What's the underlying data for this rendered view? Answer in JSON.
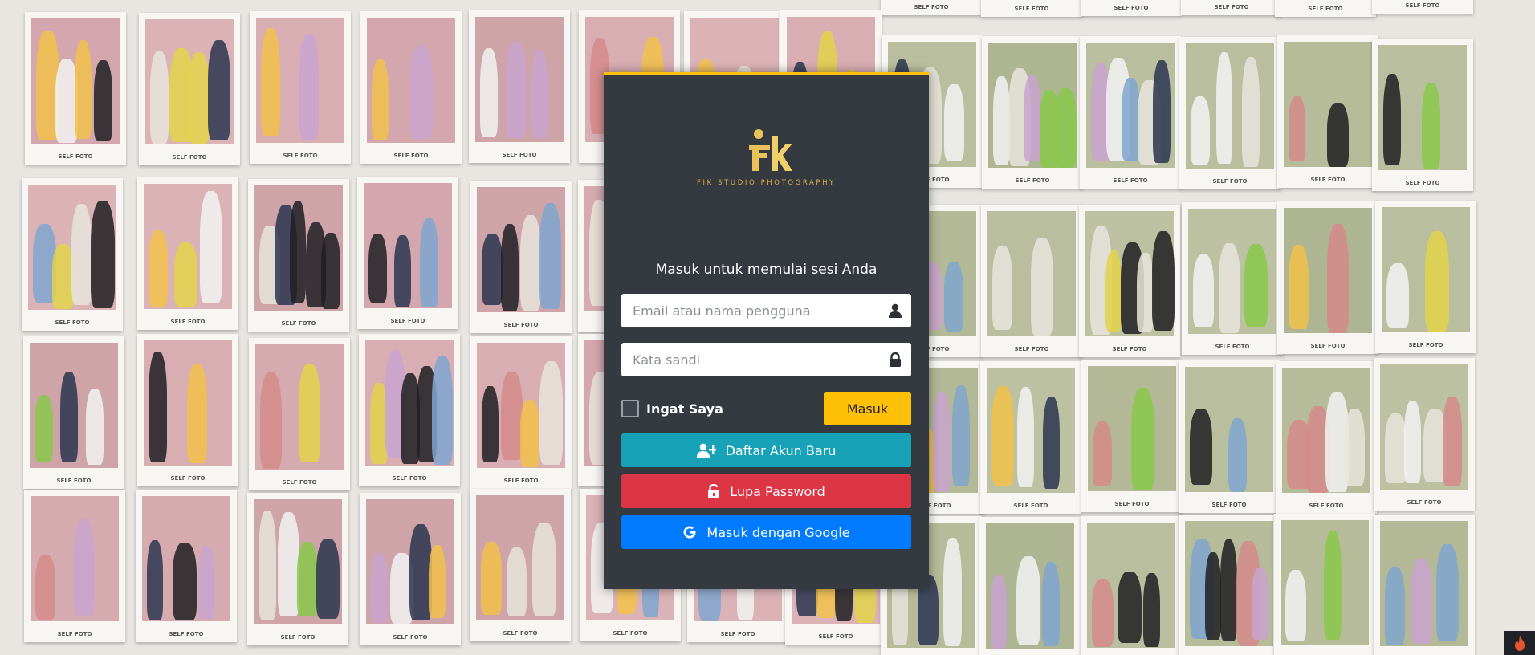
{
  "brand": {
    "name": "FIK STUDIO PHOTOGRAPHY",
    "accent_color": "#ffc107"
  },
  "login": {
    "message": "Masuk untuk memulai sesi Anda",
    "username_placeholder": "Email atau nama pengguna",
    "password_placeholder": "Kata sandi",
    "remember_label": "Ingat Saya",
    "submit_label": "Masuk",
    "register_label": "Daftar Akun Baru",
    "forgot_label": "Lupa Password",
    "google_label": "Masuk dengan Google"
  },
  "icons": {
    "username": "user-icon",
    "password": "lock-icon",
    "register": "user-plus-icon",
    "forgot": "unlock-icon",
    "google": "google-icon",
    "corner": "flame-icon"
  },
  "background": {
    "print_caption": "SELF FOTO"
  }
}
